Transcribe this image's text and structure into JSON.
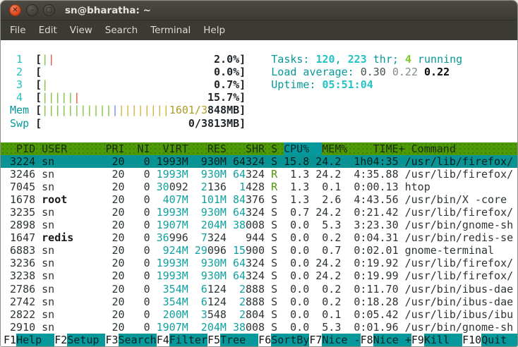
{
  "window": {
    "title": "sn@bharatha: ~"
  },
  "menu": {
    "items": [
      "File",
      "Edit",
      "View",
      "Search",
      "Terminal",
      "Help"
    ]
  },
  "htop": {
    "meters": [
      {
        "type": "cpu",
        "label": "1",
        "bars": [
          "green",
          "red"
        ],
        "value": "2.0%"
      },
      {
        "type": "cpu",
        "label": "2",
        "bars": [],
        "value": "0.0%"
      },
      {
        "type": "cpu",
        "label": "3",
        "bars": [
          "green"
        ],
        "value": "0.7%"
      },
      {
        "type": "cpu",
        "label": "4",
        "bars": [
          "green",
          "green",
          "green",
          "green",
          "green",
          "red"
        ],
        "value": "15.7%"
      },
      {
        "type": "mem",
        "label": "Mem",
        "bars": [
          "green",
          "green",
          "green",
          "green",
          "green",
          "green",
          "green",
          "green",
          "green",
          "green",
          "green",
          "blue",
          "yellow",
          "yellow",
          "yellow",
          "yellow",
          "yellow",
          "yellow",
          "yellow",
          "yellow"
        ],
        "value_hi": "1601/3",
        "value_lo": "848MB"
      },
      {
        "type": "swp",
        "label": "Swp",
        "bars": [],
        "value": "0/3813MB"
      }
    ],
    "summary": {
      "tasks": [
        {
          "text": "Tasks: ",
          "style": "label"
        },
        {
          "text": "120",
          "style": "cyan"
        },
        {
          "text": ", ",
          "style": "label"
        },
        {
          "text": "223",
          "style": "cyan"
        },
        {
          "text": " thr; ",
          "style": "label"
        },
        {
          "text": "4",
          "style": "green"
        },
        {
          "text": " running",
          "style": "label"
        }
      ],
      "load": [
        {
          "text": "Load average: ",
          "style": "label"
        },
        {
          "text": "0.30 ",
          "style": "load1"
        },
        {
          "text": "0.22 ",
          "style": "load2"
        },
        {
          "text": "0.22",
          "style": "load3"
        }
      ],
      "uptime": [
        {
          "text": "Uptime: ",
          "style": "label"
        },
        {
          "text": "05:51:04",
          "style": "cyan"
        }
      ]
    },
    "table": {
      "columns": [
        "PID",
        "USER",
        "PRI",
        "NI",
        "VIRT",
        "RES",
        "SHR",
        "S",
        "CPU%",
        "MEM%",
        "TIME+",
        "Command"
      ],
      "sort_column": "CPU%",
      "rows": [
        {
          "pid": "3224",
          "user": "sn",
          "bold_user": false,
          "pri": "20",
          "ni": "0",
          "virt": {
            "hi": "1993M",
            "lo": ""
          },
          "res": {
            "hi": "930M",
            "lo": ""
          },
          "shr": {
            "hi": "64",
            "lo": "324"
          },
          "state": "S",
          "cpu": "15.8",
          "mem": "24.2",
          "time": "1h04:35",
          "command": "/usr/lib/firefox/",
          "selected": true
        },
        {
          "pid": "3246",
          "user": "sn",
          "bold_user": false,
          "pri": "20",
          "ni": "0",
          "virt": {
            "hi": "1993M",
            "lo": ""
          },
          "res": {
            "hi": "930M",
            "lo": ""
          },
          "shr": {
            "hi": "64",
            "lo": "324"
          },
          "state": "R",
          "cpu": "1.3",
          "mem": "24.2",
          "time": "4:35.88",
          "command": "/usr/lib/firefox/",
          "selected": false
        },
        {
          "pid": "7045",
          "user": "sn",
          "bold_user": false,
          "pri": "20",
          "ni": "0",
          "virt": {
            "hi": "30",
            "lo": "092"
          },
          "res": {
            "hi": "2",
            "lo": "136"
          },
          "shr": {
            "hi": "1",
            "lo": "428"
          },
          "state": "R",
          "cpu": "1.3",
          "mem": "0.1",
          "time": "0:00.13",
          "command": "htop",
          "selected": false
        },
        {
          "pid": "1678",
          "user": "root",
          "bold_user": true,
          "pri": "20",
          "ni": "0",
          "virt": {
            "hi": "407M",
            "lo": ""
          },
          "res": {
            "hi": "101M",
            "lo": ""
          },
          "shr": {
            "hi": "84",
            "lo": "376"
          },
          "state": "S",
          "cpu": "1.3",
          "mem": "2.6",
          "time": "4:43.56",
          "command": "/usr/bin/X -core",
          "selected": false
        },
        {
          "pid": "3235",
          "user": "sn",
          "bold_user": false,
          "pri": "20",
          "ni": "0",
          "virt": {
            "hi": "1993M",
            "lo": ""
          },
          "res": {
            "hi": "930M",
            "lo": ""
          },
          "shr": {
            "hi": "64",
            "lo": "324"
          },
          "state": "S",
          "cpu": "0.7",
          "mem": "24.2",
          "time": "0:21.42",
          "command": "/usr/lib/firefox/",
          "selected": false
        },
        {
          "pid": "2898",
          "user": "sn",
          "bold_user": false,
          "pri": "20",
          "ni": "0",
          "virt": {
            "hi": "1907M",
            "lo": ""
          },
          "res": {
            "hi": "204M",
            "lo": ""
          },
          "shr": {
            "hi": "38",
            "lo": "008"
          },
          "state": "S",
          "cpu": "0.0",
          "mem": "5.3",
          "time": "3:23.30",
          "command": "/usr/bin/gnome-sh",
          "selected": false
        },
        {
          "pid": "1647",
          "user": "redis",
          "bold_user": true,
          "pri": "20",
          "ni": "0",
          "virt": {
            "hi": "36",
            "lo": "996"
          },
          "res": {
            "hi": "7",
            "lo": "324"
          },
          "shr": {
            "hi": "",
            "lo": "944"
          },
          "state": "S",
          "cpu": "0.0",
          "mem": "0.2",
          "time": "0:04.31",
          "command": "/usr/bin/redis-se",
          "selected": false
        },
        {
          "pid": "6883",
          "user": "sn",
          "bold_user": false,
          "pri": "20",
          "ni": "0",
          "virt": {
            "hi": "924M",
            "lo": ""
          },
          "res": {
            "hi": "29",
            "lo": "096"
          },
          "shr": {
            "hi": "15",
            "lo": "900"
          },
          "state": "S",
          "cpu": "0.0",
          "mem": "0.7",
          "time": "0:02.01",
          "command": "gnome-terminal",
          "selected": false
        },
        {
          "pid": "3236",
          "user": "sn",
          "bold_user": false,
          "pri": "20",
          "ni": "0",
          "virt": {
            "hi": "1993M",
            "lo": ""
          },
          "res": {
            "hi": "930M",
            "lo": ""
          },
          "shr": {
            "hi": "64",
            "lo": "324"
          },
          "state": "S",
          "cpu": "0.0",
          "mem": "24.2",
          "time": "0:19.92",
          "command": "/usr/lib/firefox/",
          "selected": false
        },
        {
          "pid": "3238",
          "user": "sn",
          "bold_user": false,
          "pri": "20",
          "ni": "0",
          "virt": {
            "hi": "1993M",
            "lo": ""
          },
          "res": {
            "hi": "930M",
            "lo": ""
          },
          "shr": {
            "hi": "64",
            "lo": "324"
          },
          "state": "S",
          "cpu": "0.0",
          "mem": "24.2",
          "time": "0:19.99",
          "command": "/usr/lib/firefox/",
          "selected": false
        },
        {
          "pid": "2786",
          "user": "sn",
          "bold_user": false,
          "pri": "20",
          "ni": "0",
          "virt": {
            "hi": "354M",
            "lo": ""
          },
          "res": {
            "hi": "6",
            "lo": "124"
          },
          "shr": {
            "hi": "2",
            "lo": "888"
          },
          "state": "S",
          "cpu": "0.0",
          "mem": "0.2",
          "time": "0:11.70",
          "command": "/usr/bin/ibus-dae",
          "selected": false
        },
        {
          "pid": "2742",
          "user": "sn",
          "bold_user": false,
          "pri": "20",
          "ni": "0",
          "virt": {
            "hi": "354M",
            "lo": ""
          },
          "res": {
            "hi": "6",
            "lo": "124"
          },
          "shr": {
            "hi": "2",
            "lo": "888"
          },
          "state": "S",
          "cpu": "0.0",
          "mem": "0.2",
          "time": "0:18.28",
          "command": "/usr/bin/ibus-dae",
          "selected": false
        },
        {
          "pid": "2822",
          "user": "sn",
          "bold_user": false,
          "pri": "20",
          "ni": "0",
          "virt": {
            "hi": "200M",
            "lo": ""
          },
          "res": {
            "hi": "3",
            "lo": "548"
          },
          "shr": {
            "hi": "2",
            "lo": "804"
          },
          "state": "S",
          "cpu": "0.0",
          "mem": "0.1",
          "time": "0:05.42",
          "command": "/usr/lib/ibus/ibu",
          "selected": false
        },
        {
          "pid": "2910",
          "user": "sn",
          "bold_user": false,
          "pri": "20",
          "ni": "0",
          "virt": {
            "hi": "1907M",
            "lo": ""
          },
          "res": {
            "hi": "204M",
            "lo": ""
          },
          "shr": {
            "hi": "38",
            "lo": "008"
          },
          "state": "S",
          "cpu": "0.0",
          "mem": "5.3",
          "time": "0:01.96",
          "command": "/usr/bin/gnome-sh",
          "selected": false
        }
      ]
    },
    "fkeys": [
      {
        "key": "F1",
        "label": "Help"
      },
      {
        "key": "F2",
        "label": "Setup"
      },
      {
        "key": "F3",
        "label": "Search"
      },
      {
        "key": "F4",
        "label": "Filter"
      },
      {
        "key": "F5",
        "label": "Tree"
      },
      {
        "key": "F6",
        "label": "SortBy"
      },
      {
        "key": "F7",
        "label": "Nice -"
      },
      {
        "key": "F8",
        "label": "Nice +"
      },
      {
        "key": "F9",
        "label": "Kill"
      },
      {
        "key": "F10",
        "label": "Quit"
      }
    ]
  },
  "colors": {
    "teal": "#06989A",
    "cyan_bright": "#25C2C2",
    "green_text": "#4E9A06",
    "green_bright": "#7CC92F",
    "bar_green": "#76BE2F",
    "bar_red": "#DC4632",
    "bar_blue": "#5B8AC9",
    "bar_yellow": "#CFAF28",
    "olive_text": "#AE9C22",
    "mem_value_cyan": "#12A0A0",
    "header_bg": "#4E9A06",
    "selected_bg": "#0A9394",
    "fg": "#2E3436",
    "titlebar_bg": "#3C3A35",
    "close_button": "#DC4B20"
  }
}
